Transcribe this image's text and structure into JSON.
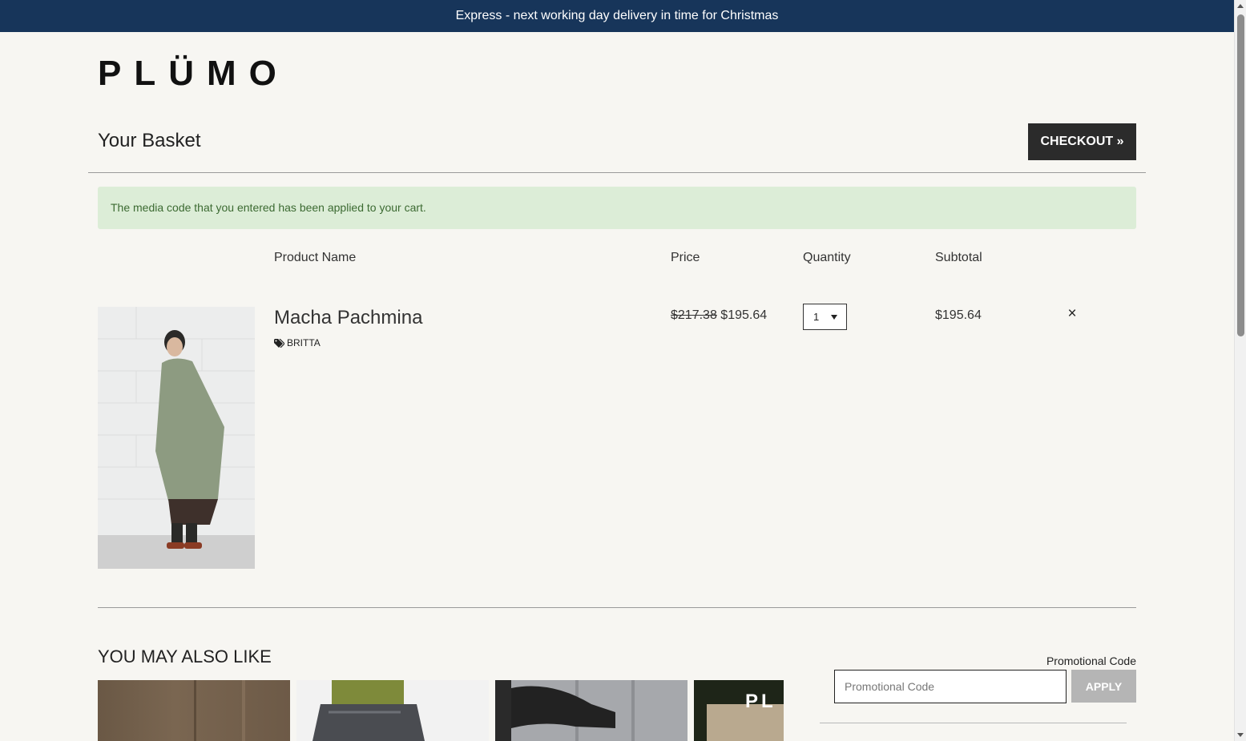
{
  "announcement": "Express - next working day delivery in time for Christmas",
  "brand": {
    "logo_text": "PLÜMO"
  },
  "basket": {
    "title": "Your Basket",
    "checkout_label": "CHECKOUT »"
  },
  "alert": {
    "message": "The media code that you entered has been applied to your cart."
  },
  "table": {
    "headers": {
      "product": "Product Name",
      "price": "Price",
      "quantity": "Quantity",
      "subtotal": "Subtotal"
    }
  },
  "items": [
    {
      "name": "Macha Pachmina",
      "tag": "BRITTA",
      "old_price": "$217.38",
      "price": "$195.64",
      "quantity": "1",
      "subtotal": "$195.64",
      "remove_label": "×"
    }
  ],
  "recommendations": {
    "title": "YOU MAY ALSO LIKE"
  },
  "promo": {
    "label": "Promotional Code",
    "placeholder": "Promotional Code",
    "apply_label": "APPLY"
  },
  "icons": {
    "tag": "tag-icon",
    "remove": "close-icon",
    "dropdown": "chevron-down-icon"
  },
  "colors": {
    "topbar": "#17355a",
    "checkout": "#2b2b2b",
    "alert_bg": "#dcedd7",
    "alert_text": "#3c6a32",
    "apply": "#b5b5b5"
  }
}
